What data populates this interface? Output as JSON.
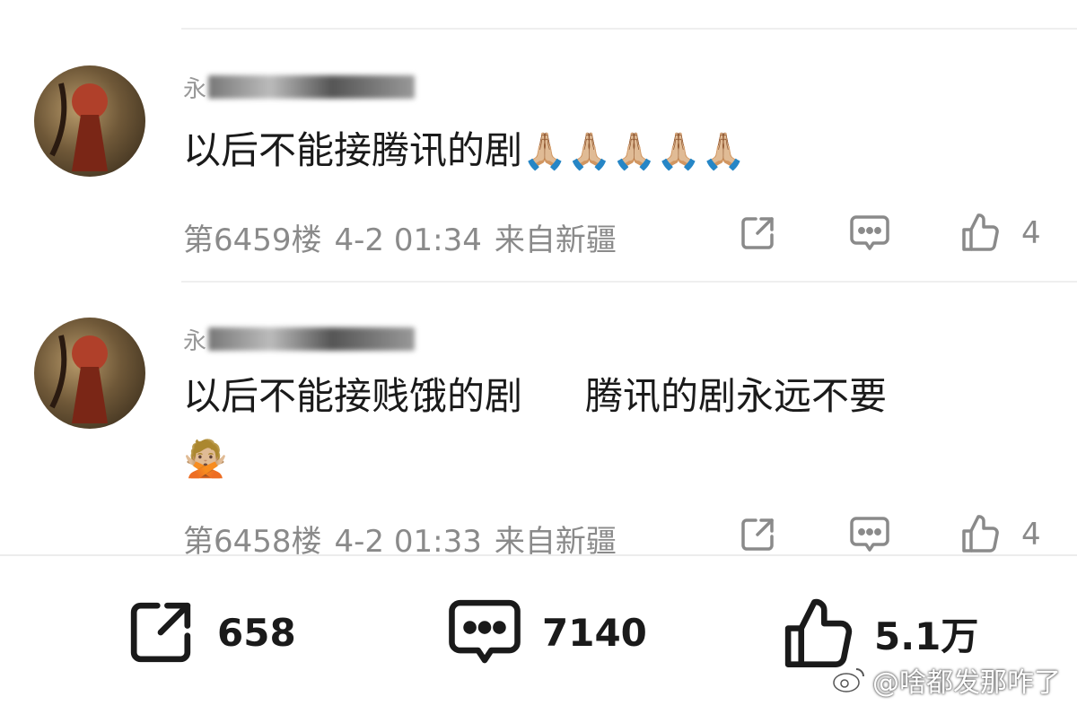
{
  "comments": [
    {
      "username_visible": "永",
      "text": "以后不能接腾讯的剧",
      "text_part2": "",
      "emoji": "🙏🏼🙏🏼🙏🏼🙏🏼🙏🏼",
      "floor": "第6459楼",
      "time": "4-2 01:34",
      "location": "来自新疆",
      "likes": "4"
    },
    {
      "username_visible": "永",
      "text": "以后不能接贱饿的剧",
      "text_part2": "腾讯的剧永远不要",
      "emoji": "🙅🏼",
      "floor": "第6458楼",
      "time": "4-2 01:33",
      "location": "来自新疆",
      "likes": "4"
    }
  ],
  "bottom_bar": {
    "share_count": "658",
    "comment_count": "7140",
    "like_count": "5.1万"
  },
  "watermark": "@啥都发那咋了",
  "colors": {
    "text": "#1a1a1a",
    "meta": "#8a8a8a",
    "divider": "#efefef"
  }
}
